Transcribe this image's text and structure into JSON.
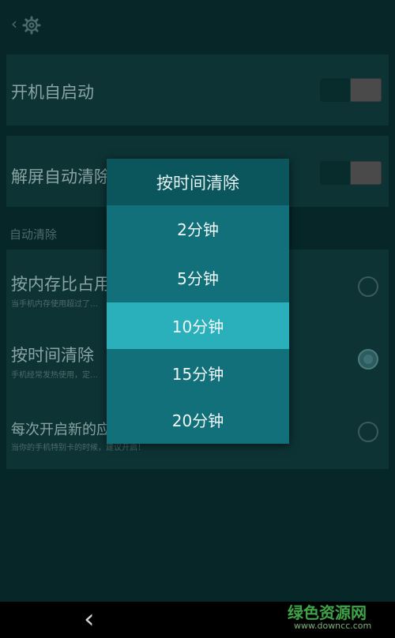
{
  "header": {
    "back_glyph": "‹",
    "icon": "gear-icon"
  },
  "settings": {
    "boot_autostart": {
      "title": "开机自启动",
      "toggle_on": false
    },
    "unlock_autoclean": {
      "title": "解屏自动清除",
      "toggle_on": false
    }
  },
  "section_label": "自动清除",
  "options": [
    {
      "title": "按内存比占用",
      "subtitle": "当手机内存使用超过了…",
      "checked": false
    },
    {
      "title": "按时间清除",
      "subtitle": "手机经常发热使用，定…",
      "checked": true
    },
    {
      "title": "每次开启新的应",
      "subtitle": "当你的手机特别卡的时候，建议开启！",
      "checked": false
    }
  ],
  "dialog": {
    "title": "按时间清除",
    "choices": [
      "2分钟",
      "5分钟",
      "10分钟",
      "15分钟",
      "20分钟"
    ],
    "selected_index": 2
  },
  "navbar": {
    "back_glyph": "‹"
  },
  "watermark": {
    "brand": "绿色资源网",
    "url": "www.downcc.com"
  },
  "colors": {
    "accent": "#2ab0bb",
    "dialog_bg": "#11707a",
    "page_bg": "#062628"
  }
}
